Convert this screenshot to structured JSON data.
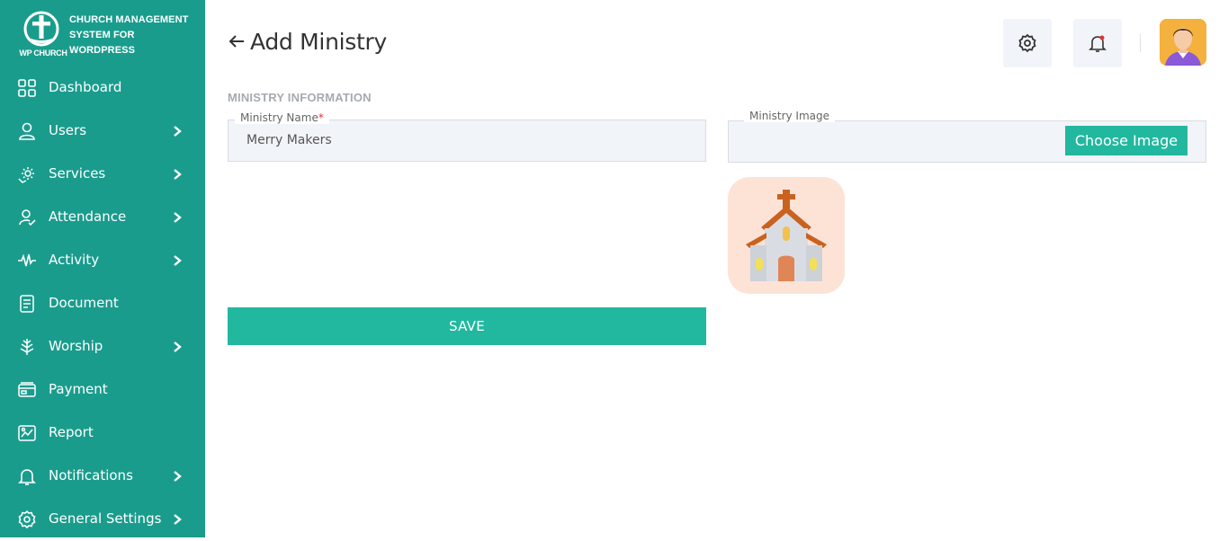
{
  "brand": {
    "title_lines": [
      "CHURCH MANAGEMENT",
      "SYSTEM FOR",
      "WORDPRESS"
    ],
    "sub": "WP CHURCH",
    "colors": {
      "sidebar": "#1a9c8d",
      "accent": "#22b89f"
    }
  },
  "sidebar": {
    "items": [
      {
        "label": "Dashboard",
        "icon": "grid-icon",
        "has_submenu": false
      },
      {
        "label": "Users",
        "icon": "user-icon",
        "has_submenu": true
      },
      {
        "label": "Services",
        "icon": "services-icon",
        "has_submenu": true
      },
      {
        "label": "Attendance",
        "icon": "attendance-icon",
        "has_submenu": true
      },
      {
        "label": "Activity",
        "icon": "activity-icon",
        "has_submenu": true
      },
      {
        "label": "Document",
        "icon": "document-icon",
        "has_submenu": false
      },
      {
        "label": "Worship",
        "icon": "worship-icon",
        "has_submenu": true
      },
      {
        "label": "Payment",
        "icon": "payment-icon",
        "has_submenu": false
      },
      {
        "label": "Report",
        "icon": "report-icon",
        "has_submenu": false
      },
      {
        "label": "Notifications",
        "icon": "bell-icon",
        "has_submenu": true
      },
      {
        "label": "General Settings",
        "icon": "gear-icon",
        "has_submenu": true
      }
    ]
  },
  "header": {
    "title": "Add Ministry",
    "back_icon": "arrow-left-icon",
    "settings_icon": "gear-icon",
    "notifications_icon": "bell-icon",
    "avatar_icon": "user-avatar"
  },
  "form": {
    "section_label": "MINISTRY INFORMATION",
    "name_label": "Ministry Name",
    "name_required_mark": "*",
    "name_value": "Merry Makers",
    "image_label": "Ministry Image",
    "choose_image_label": "Choose Image",
    "preview_icon": "church-icon",
    "save_label": "SAVE"
  }
}
